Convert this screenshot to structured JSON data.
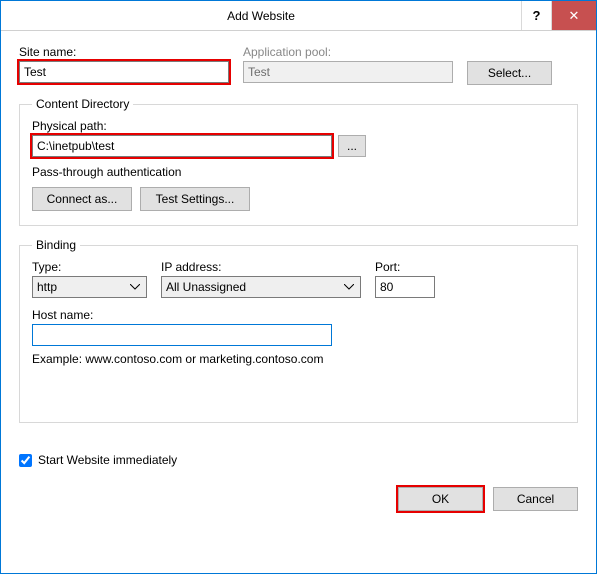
{
  "titlebar": {
    "title": "Add Website",
    "help": "?",
    "close": "✕"
  },
  "site_name": {
    "label": "Site name:",
    "value": "Test"
  },
  "app_pool": {
    "label": "Application pool:",
    "value": "Test",
    "select_btn": "Select..."
  },
  "content_dir": {
    "legend": "Content Directory",
    "physical_path_label": "Physical path:",
    "physical_path_value": "C:\\inetpub\\test",
    "browse_btn": "...",
    "passthrough_label": "Pass-through authentication",
    "connect_as_btn": "Connect as...",
    "test_settings_btn": "Test Settings..."
  },
  "binding": {
    "legend": "Binding",
    "type_label": "Type:",
    "type_value": "http",
    "ip_label": "IP address:",
    "ip_value": "All Unassigned",
    "port_label": "Port:",
    "port_value": "80",
    "hostname_label": "Host name:",
    "hostname_value": "",
    "example_text": "Example: www.contoso.com or marketing.contoso.com"
  },
  "start_immediately": {
    "label": "Start Website immediately",
    "checked": true
  },
  "buttons": {
    "ok": "OK",
    "cancel": "Cancel"
  }
}
